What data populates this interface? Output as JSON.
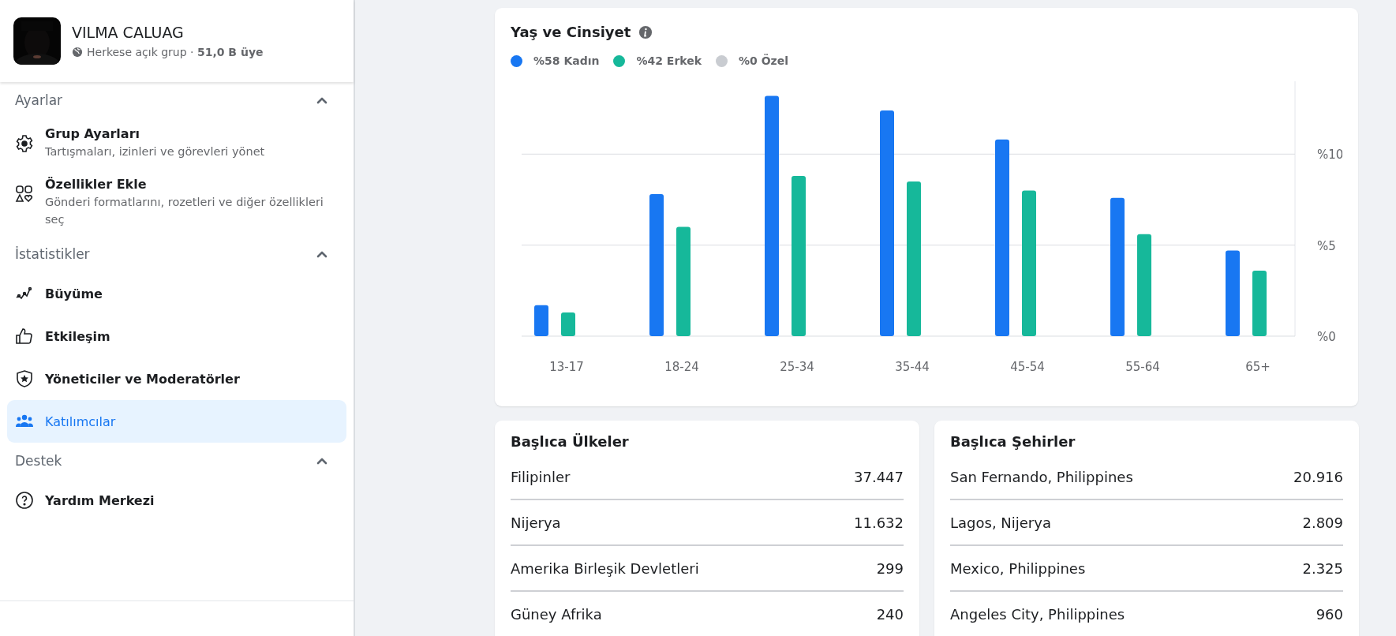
{
  "group": {
    "name": "VILMA CALUAG",
    "subtitle": "Herkese açık grup · **51,0 B üye**"
  },
  "sidebar": {
    "sections": [
      {
        "title": "Ayarlar",
        "expanded": true,
        "items": [
          {
            "label": "Grup Ayarları",
            "description": "Tartışmaları, izinleri ve görevleri yönet",
            "selected": false
          },
          {
            "label": "Özellikler Ekle",
            "description": "Gönderi formatlarını, rozetleri ve diğer özellikleri seç",
            "selected": false
          }
        ]
      },
      {
        "title": "İstatistikler",
        "expanded": true,
        "items": [
          {
            "label": "Büyüme",
            "selected": false
          },
          {
            "label": "Etkileşim",
            "selected": false
          },
          {
            "label": "Yöneticiler ve Moderatörler",
            "selected": false
          },
          {
            "label": "Katılımcılar",
            "selected": true
          }
        ]
      },
      {
        "title": "Destek",
        "expanded": true,
        "items": [
          {
            "label": "Yardım Merkezi",
            "selected": false
          }
        ]
      }
    ]
  },
  "age_gender": {
    "title": "Yaş ve Cinsiyet",
    "legend": [
      {
        "label": "%58 Kadın",
        "color": "#1877f2"
      },
      {
        "label": "%42 Erkek",
        "color": "#16b89a"
      },
      {
        "label": "%0 Özel",
        "color": "#c9ccd1"
      }
    ],
    "chart_data": {
      "type": "bar",
      "categories": [
        "13-17",
        "18-24",
        "25-34",
        "35-44",
        "45-54",
        "55-64",
        "65+"
      ],
      "series": [
        {
          "color": "#1877f2",
          "values": [
            1.7,
            7.8,
            13.2,
            12.4,
            10.8,
            7.6,
            4.7
          ]
        },
        {
          "color": "#16b89a",
          "values": [
            1.3,
            6.0,
            8.8,
            8.5,
            8.0,
            5.6,
            3.6
          ]
        }
      ],
      "ylim": [
        0,
        14
      ],
      "yticks": [
        {
          "value": 0,
          "label": "%0"
        },
        {
          "value": 5,
          "label": "%5"
        },
        {
          "value": 10,
          "label": "%10"
        }
      ]
    }
  },
  "top_countries": {
    "title": "Başlıca Ülkeler",
    "rows": [
      {
        "name": "Filipinler",
        "value": "37.447"
      },
      {
        "name": "Nijerya",
        "value": "11.632"
      },
      {
        "name": "Amerika Birleşik Devletleri",
        "value": "299"
      },
      {
        "name": "Güney Afrika",
        "value": "240"
      }
    ]
  },
  "top_cities": {
    "title": "Başlıca Şehirler",
    "rows": [
      {
        "name": "San Fernando, Philippines",
        "value": "20.916"
      },
      {
        "name": "Lagos, Nijerya",
        "value": "2.809"
      },
      {
        "name": "Mexico, Philippines",
        "value": "2.325"
      },
      {
        "name": "Angeles City, Philippines",
        "value": "960"
      }
    ]
  }
}
